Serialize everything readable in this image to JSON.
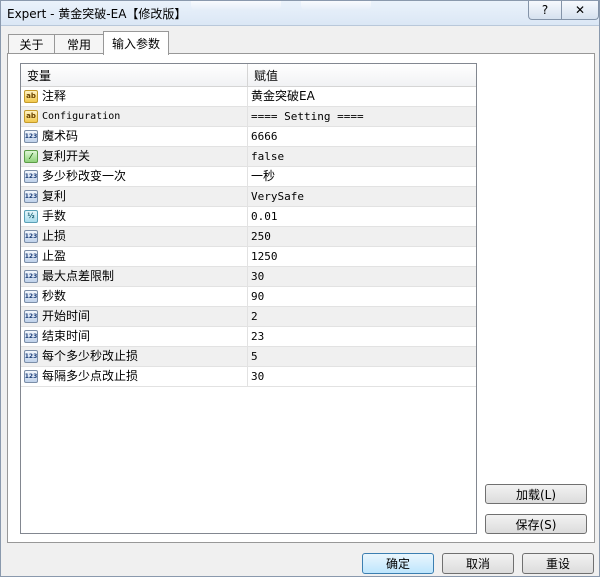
{
  "window": {
    "title": "Expert - 黄金突破-EA【修改版】",
    "help_glyph": "?",
    "close_glyph": "✕"
  },
  "tabs": [
    {
      "label": "关于",
      "active": false
    },
    {
      "label": "常用",
      "active": false
    },
    {
      "label": "输入参数",
      "active": true
    }
  ],
  "grid": {
    "col_variable": "变量",
    "col_value": "赋值",
    "rows": [
      {
        "type": "string",
        "icon_text": "ab",
        "name": "注释",
        "value": "黄金突破EA"
      },
      {
        "type": "string",
        "icon_text": "ab",
        "name": "Configuration",
        "value": "==== Setting ===="
      },
      {
        "type": "int",
        "icon_text": "123",
        "name": "魔术码",
        "value": "6666"
      },
      {
        "type": "bool",
        "icon_text": "⁄",
        "name": "复利开关",
        "value": "false"
      },
      {
        "type": "int",
        "icon_text": "123",
        "name": "多少秒改变一次",
        "value": "一秒"
      },
      {
        "type": "int",
        "icon_text": "123",
        "name": "复利",
        "value": "VerySafe"
      },
      {
        "type": "double",
        "icon_text": "½",
        "name": "手数",
        "value": "0.01"
      },
      {
        "type": "int",
        "icon_text": "123",
        "name": "止损",
        "value": "250"
      },
      {
        "type": "int",
        "icon_text": "123",
        "name": "止盈",
        "value": "1250"
      },
      {
        "type": "int",
        "icon_text": "123",
        "name": "最大点差限制",
        "value": "30"
      },
      {
        "type": "int",
        "icon_text": "123",
        "name": "秒数",
        "value": "90"
      },
      {
        "type": "int",
        "icon_text": "123",
        "name": "开始时间",
        "value": "2"
      },
      {
        "type": "int",
        "icon_text": "123",
        "name": "结束时间",
        "value": "23"
      },
      {
        "type": "int",
        "icon_text": "123",
        "name": "每个多少秒改止损",
        "value": "5"
      },
      {
        "type": "int",
        "icon_text": "123",
        "name": "每隔多少点改止损",
        "value": "30"
      }
    ]
  },
  "buttons": {
    "load": "加载(L)",
    "save": "保存(S)",
    "ok": "确定",
    "cancel": "取消",
    "reset": "重设"
  }
}
